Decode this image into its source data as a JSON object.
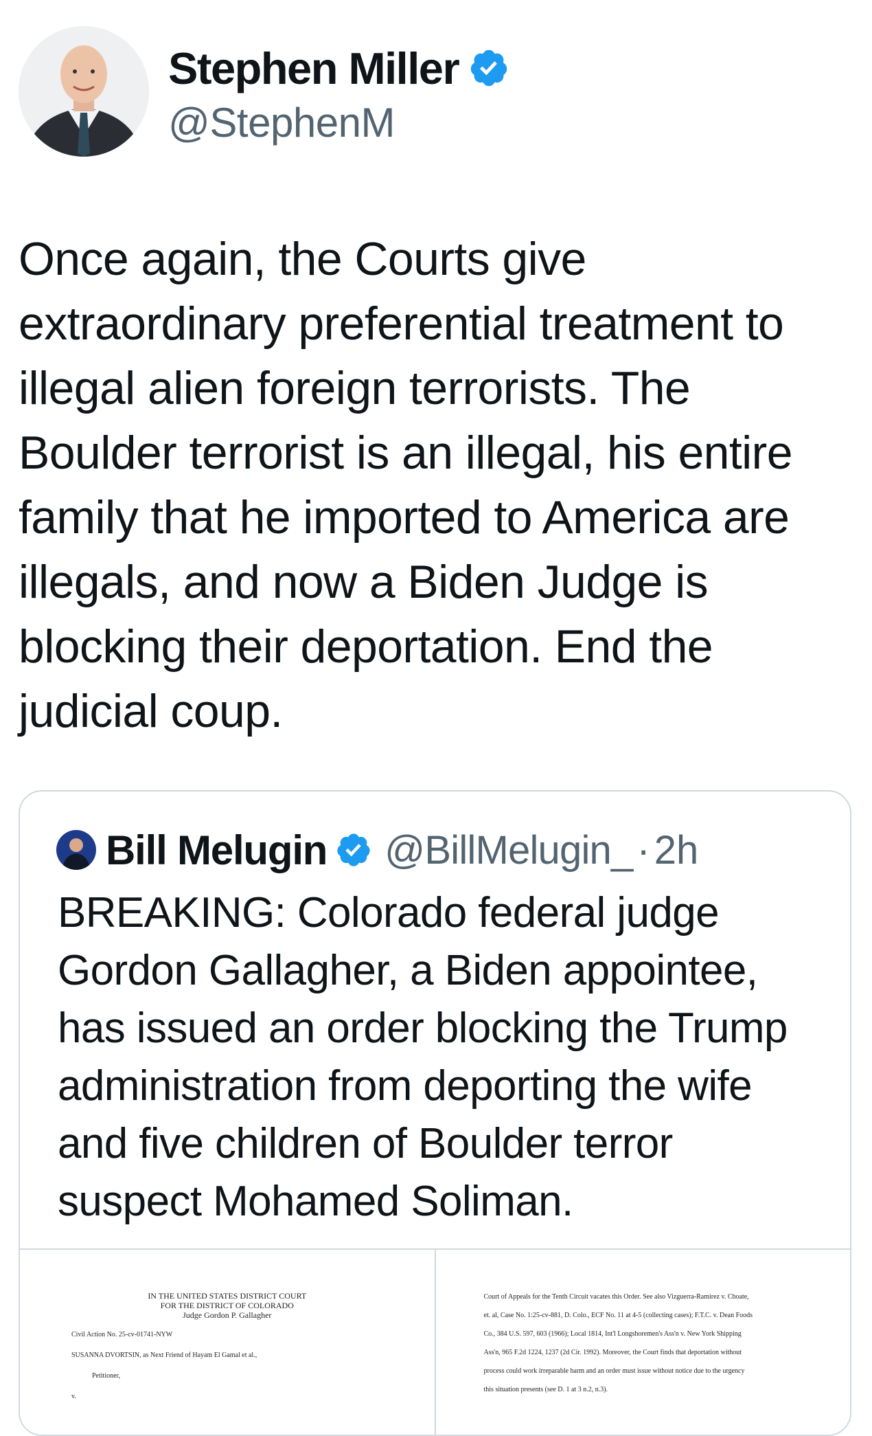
{
  "author": {
    "name": "Stephen Miller",
    "handle": "@StephenM",
    "verified_icon": "verified-badge",
    "verified_color": "#1d9bf0"
  },
  "tweet": {
    "text": "Once again, the Courts give\nextraordinary preferential treatment to\nillegal alien foreign terrorists. The\nBoulder terrorist is an illegal, his entire\nfamily that he imported to America are\nillegals, and now a Biden Judge is\nblocking their deportation. End the\njudicial coup."
  },
  "quoted_tweet": {
    "name": "Bill Melugin",
    "handle": "@BillMelugin_",
    "separator": "·",
    "time": "2h",
    "text": "BREAKING: Colorado federal judge\nGordon Gallagher, a Biden appointee,\nhas issued an order blocking the Trump\nadministration from deporting the wife\nand five children of Boulder terror\nsuspect Mohamed Soliman.",
    "documents": {
      "left": {
        "court": "IN THE UNITED STATES DISTRICT COURT\nFOR THE DISTRICT OF COLORADO\nJudge Gordon P. Gallagher",
        "civil_action": "Civil Action No. 25-cv-01741-NYW",
        "party": "SUSANNA DVORTSIN, as Next Friend of Hayam El Gamal et al.,",
        "role": "Petitioner,",
        "versus": "v."
      },
      "right": {
        "text": "Court of Appeals for the Tenth Circuit vacates this Order. See also Vizguerra-Ramirez v. Choate,\net. al, Case No. 1:25-cv-881, D. Colo., ECF No. 11 at 4-5 (collecting cases); F.T.C. v. Dean Foods\nCo., 384 U.S. 597, 603 (1966); Local 1814, Int'l Longshoremen's Ass'n v. New York Shipping\nAss'n, 965 F.2d 1224, 1237 (2d Cir. 1992). Moreover, the Court finds that deportation without\nprocess could work irreparable harm and an order must issue without notice due to the urgency\nthis situation presents (see D. 1 at 3 n.2, n.3)."
      }
    }
  }
}
